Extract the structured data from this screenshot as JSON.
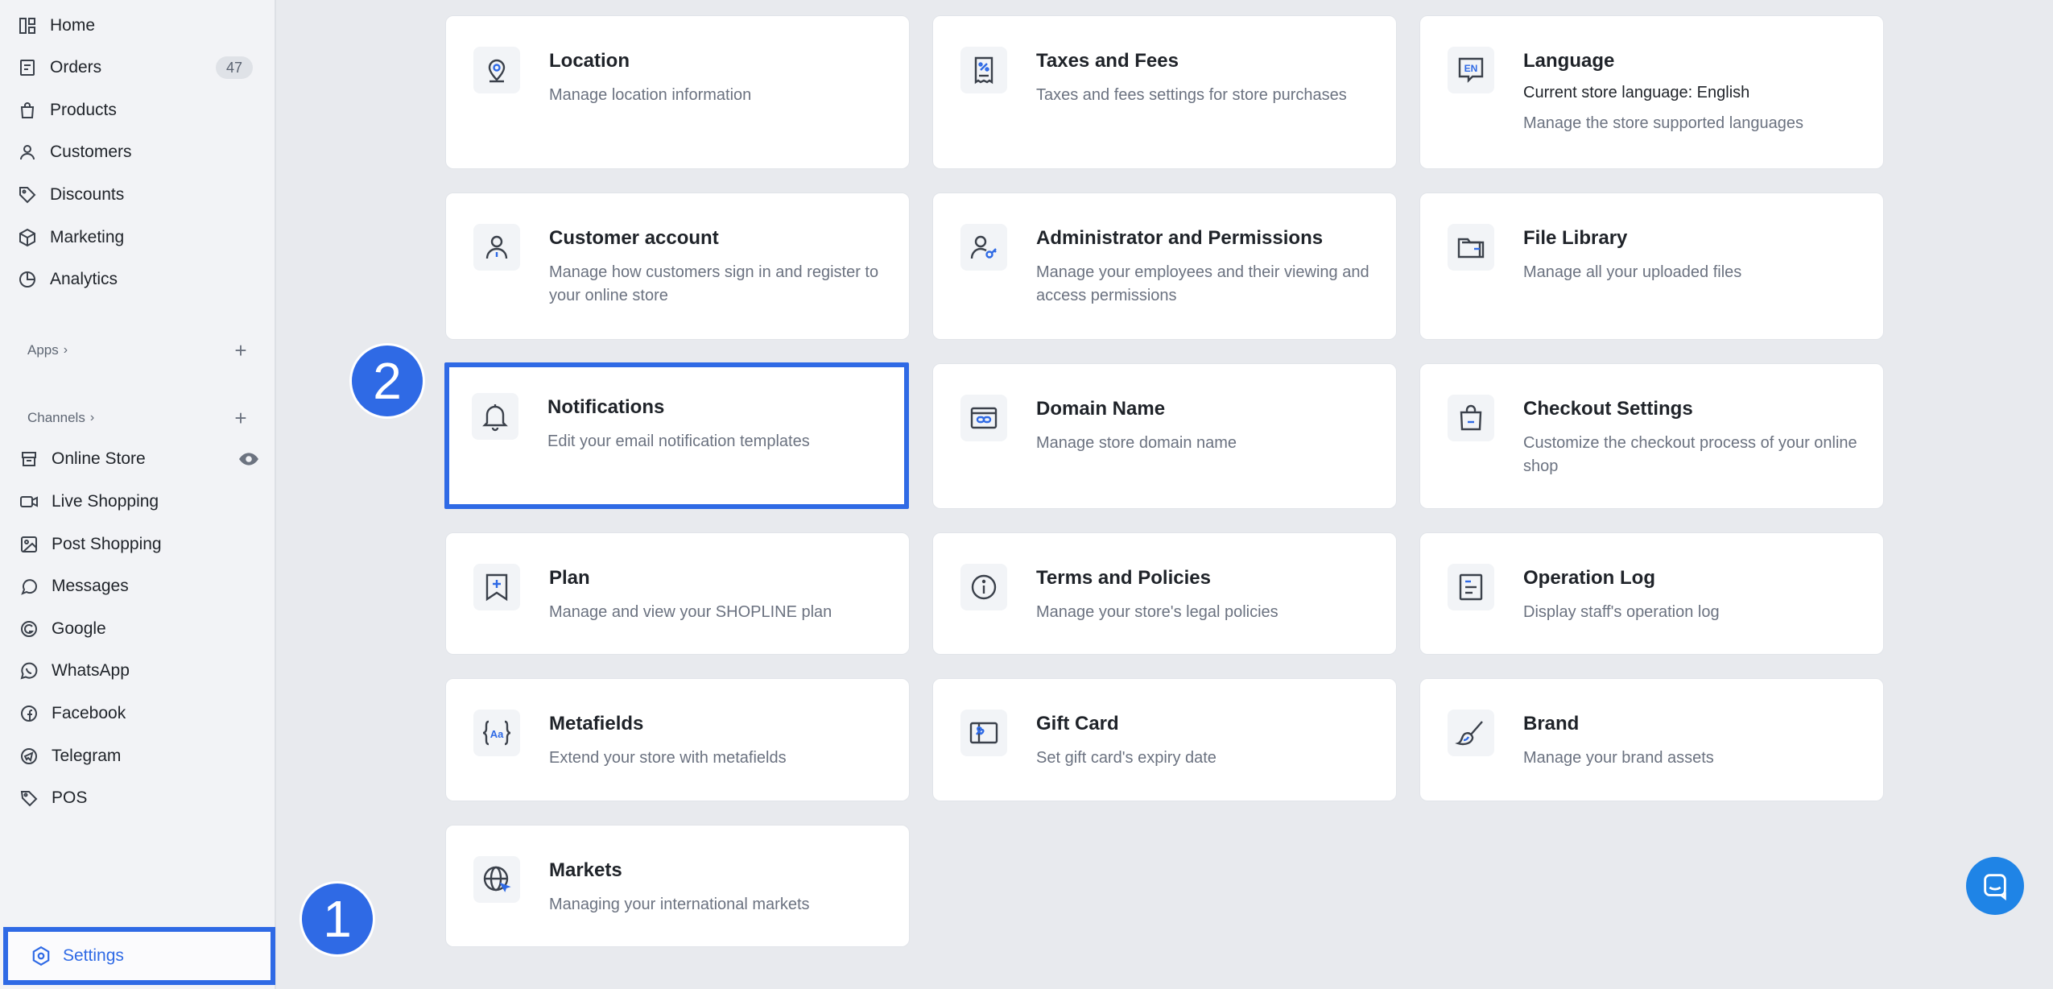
{
  "sidebar": {
    "items": [
      {
        "label": "Home",
        "icon": "home-icon"
      },
      {
        "label": "Orders",
        "icon": "orders-icon",
        "badge": "47"
      },
      {
        "label": "Products",
        "icon": "products-icon"
      },
      {
        "label": "Customers",
        "icon": "customers-icon"
      },
      {
        "label": "Discounts",
        "icon": "discounts-icon"
      },
      {
        "label": "Marketing",
        "icon": "marketing-icon"
      },
      {
        "label": "Analytics",
        "icon": "analytics-icon"
      }
    ],
    "apps_label": "Apps",
    "channels_label": "Channels",
    "channels": [
      {
        "label": "Online Store",
        "icon": "online-store-icon"
      },
      {
        "label": "Live Shopping",
        "icon": "live-shopping-icon"
      },
      {
        "label": "Post Shopping",
        "icon": "post-shopping-icon"
      },
      {
        "label": "Messages",
        "icon": "messages-icon"
      },
      {
        "label": "Google",
        "icon": "google-icon"
      },
      {
        "label": "WhatsApp",
        "icon": "whatsapp-icon"
      },
      {
        "label": "Facebook",
        "icon": "facebook-icon"
      },
      {
        "label": "Telegram",
        "icon": "telegram-icon"
      },
      {
        "label": "POS",
        "icon": "pos-icon"
      }
    ],
    "settings_label": "Settings"
  },
  "steps": {
    "step1": "1",
    "step2": "2"
  },
  "cards": {
    "location": {
      "title": "Location",
      "desc": "Manage location information"
    },
    "taxes": {
      "title": "Taxes and Fees",
      "desc": "Taxes and fees settings for store purchases"
    },
    "language": {
      "title": "Language",
      "desc_strong": "Current store language: English",
      "desc": "Manage the store supported languages"
    },
    "customer_account": {
      "title": "Customer account",
      "desc": "Manage how customers sign in and register to your online store"
    },
    "admin": {
      "title": "Administrator and Permissions",
      "desc": "Manage your employees and their viewing and access permissions"
    },
    "file_library": {
      "title": "File Library",
      "desc": "Manage all your uploaded files"
    },
    "notifications": {
      "title": "Notifications",
      "desc": "Edit your email notification templates"
    },
    "domain": {
      "title": "Domain Name",
      "desc": "Manage store domain name"
    },
    "checkout": {
      "title": "Checkout Settings",
      "desc": "Customize the checkout process of your online shop"
    },
    "plan": {
      "title": "Plan",
      "desc": "Manage and view your SHOPLINE plan"
    },
    "terms": {
      "title": "Terms and Policies",
      "desc": "Manage your store's legal policies"
    },
    "operation_log": {
      "title": "Operation Log",
      "desc": "Display staff's operation log"
    },
    "metafields": {
      "title": "Metafields",
      "desc": "Extend your store with metafields"
    },
    "gift_card": {
      "title": "Gift Card",
      "desc": "Set gift card's expiry date"
    },
    "brand": {
      "title": "Brand",
      "desc": "Manage your brand assets"
    },
    "markets": {
      "title": "Markets",
      "desc": "Managing your international markets"
    }
  },
  "colors": {
    "accent": "#2f6ae5",
    "chat": "#1f84e6",
    "page_bg": "#e8eaee"
  }
}
